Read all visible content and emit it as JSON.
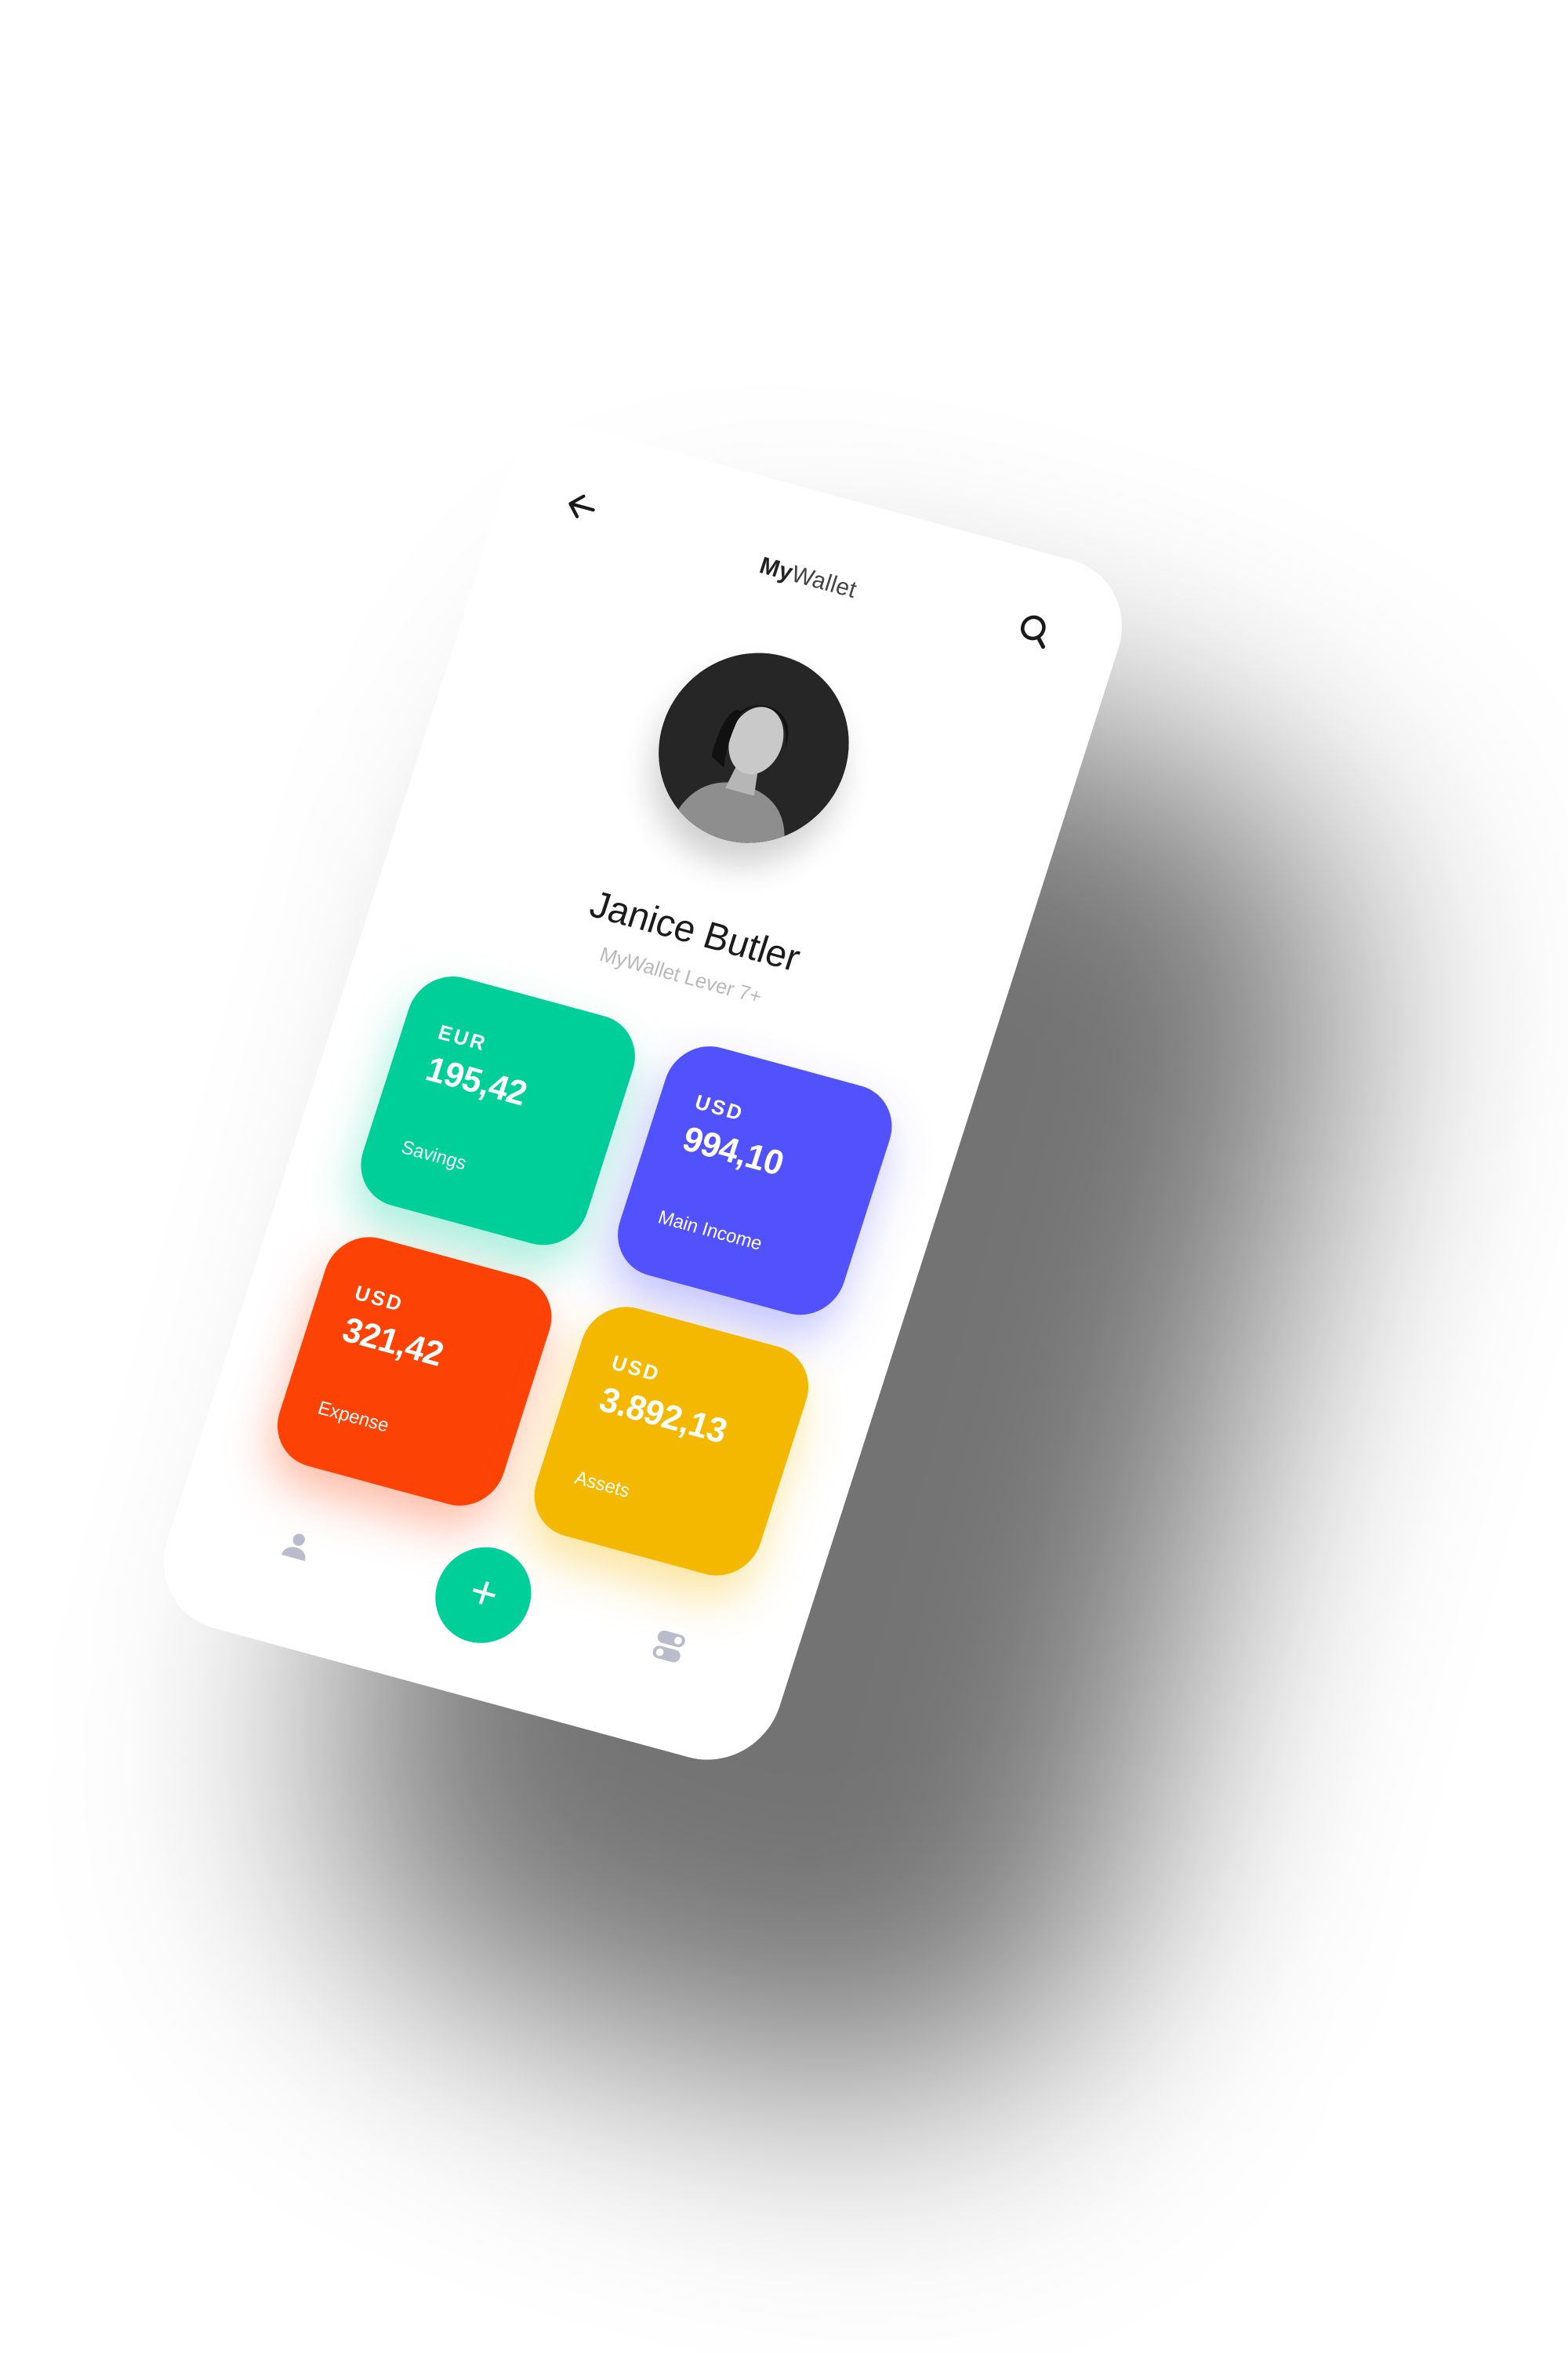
{
  "header": {
    "title_bold": "My",
    "title_light": "Wallet",
    "back_icon": "arrow-left-icon",
    "search_icon": "search-icon"
  },
  "profile": {
    "name": "Janice Butler",
    "level": "MyWallet Lever 7+"
  },
  "cards": [
    {
      "currency": "EUR",
      "amount": "195,42",
      "label": "Savings",
      "color": "#00cf99"
    },
    {
      "currency": "USD",
      "amount": "994,10",
      "label": "Main Income",
      "color": "#5252fd"
    },
    {
      "currency": "USD",
      "amount": "321,42",
      "label": "Expense",
      "color": "#fc4205"
    },
    {
      "currency": "USD",
      "amount": "3.892,13",
      "label": "Assets",
      "color": "#f5b800"
    }
  ],
  "bottom_nav": {
    "left_icon": "user-icon",
    "center_icon": "plus-icon",
    "center_label": "+",
    "center_color": "#00cf99",
    "right_icon": "toggles-icon"
  }
}
